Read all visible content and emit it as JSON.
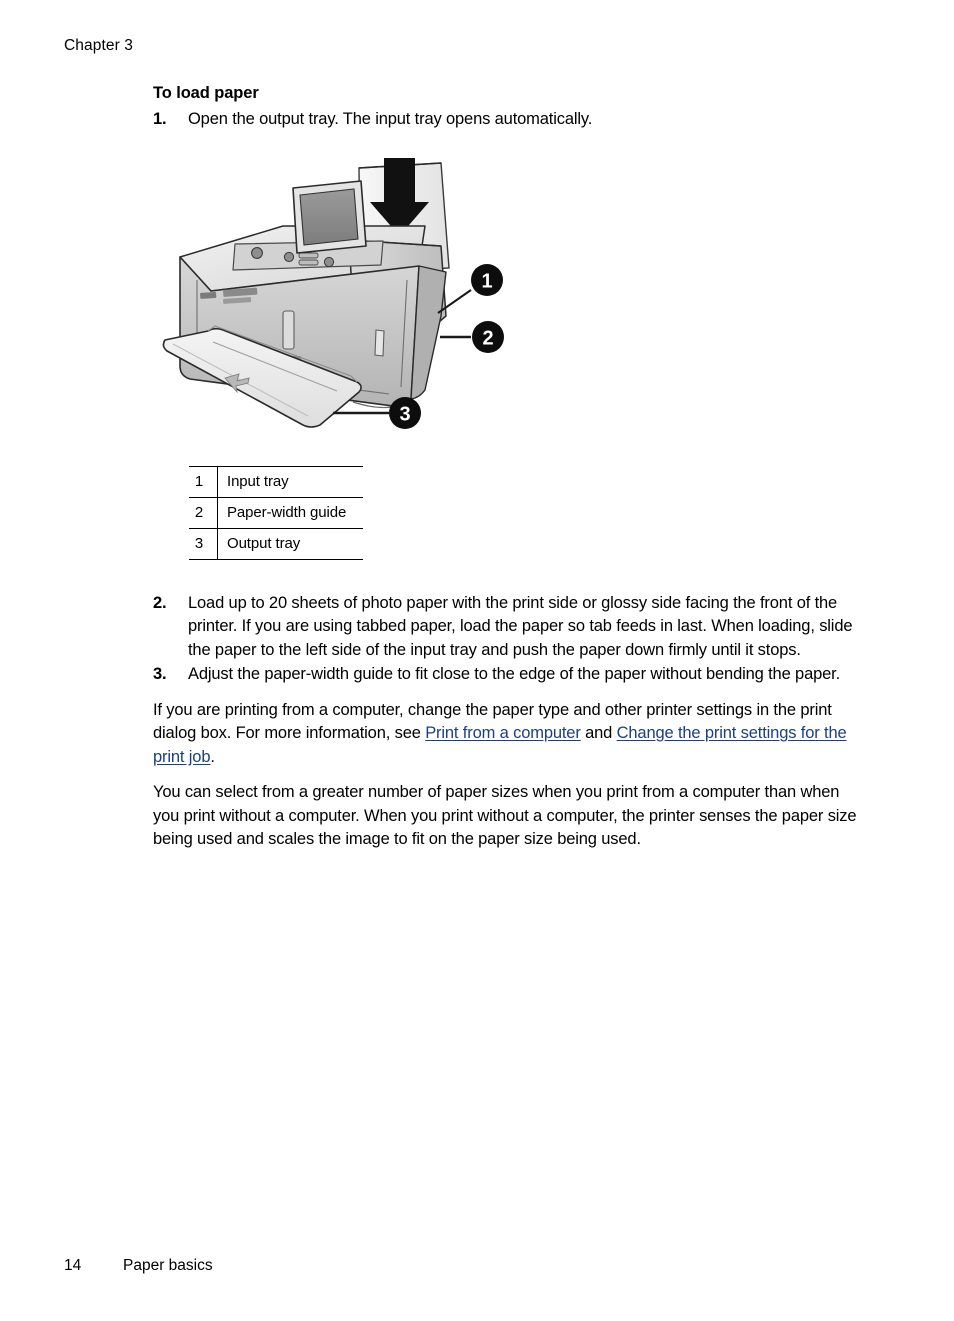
{
  "header": {
    "running_head": "Chapter 3"
  },
  "procedure": {
    "title": "To load paper",
    "steps": [
      {
        "number": "1.",
        "text": "Open the output tray. The input tray opens automatically."
      },
      {
        "number": "2.",
        "text": "Load up to 20 sheets of photo paper with the print side or glossy side facing the front of the printer. If you are using tabbed paper, load the paper so tab feeds in last. When loading, slide the paper to the left side of the input tray and push the paper down firmly until it stops."
      },
      {
        "number": "3.",
        "text": "Adjust the paper-width guide to fit close to the edge of the paper without bending the paper."
      }
    ]
  },
  "figure": {
    "alt": "HP photo printer with output tray open, input tray open and a sheet of photo paper being inserted downward",
    "callouts": [
      {
        "id": "1",
        "target": "input-tray"
      },
      {
        "id": "2",
        "target": "paper-width-guide"
      },
      {
        "id": "3",
        "target": "output-tray"
      }
    ],
    "arrow_direction": "down",
    "colors": {
      "callout_fill": "#0d0d0d",
      "callout_text": "#ffffff",
      "body_light": "#e8e8e8",
      "body_mid": "#c9c9c9",
      "body_dark": "#9a9a9a",
      "screen": "#8c8c8c",
      "outline": "#1a1a1a"
    }
  },
  "legend": {
    "rows": [
      {
        "index": "1",
        "label": "Input tray"
      },
      {
        "index": "2",
        "label": "Paper-width guide"
      },
      {
        "index": "3",
        "label": "Output tray"
      }
    ]
  },
  "paragraphs": {
    "printing_note": {
      "lead": "If you are printing from a computer, change the paper type and other printer settings in the print dialog box. For more information, see ",
      "link1": "Print from a computer",
      "conjunction": " and ",
      "link2": "Change the print settings for the print job",
      "tail": "."
    },
    "paper_sizes": "You can select from a greater number of paper sizes when you print from a computer than when you print without a computer. When you print without a computer, the printer senses the paper size being used and scales the image to fit on the paper size being used."
  },
  "footer": {
    "page_number": "14",
    "section": "Paper basics"
  }
}
